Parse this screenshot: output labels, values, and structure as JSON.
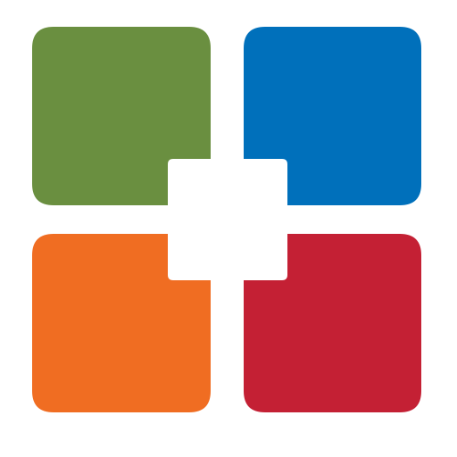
{
  "logo": {
    "icon_name": "four-quadrant-cross-logo-icon",
    "colors": {
      "background": "#ffffff",
      "green": "#6a8f40",
      "blue": "#0070bb",
      "orange": "#f06d22",
      "red": "#c42034"
    }
  }
}
